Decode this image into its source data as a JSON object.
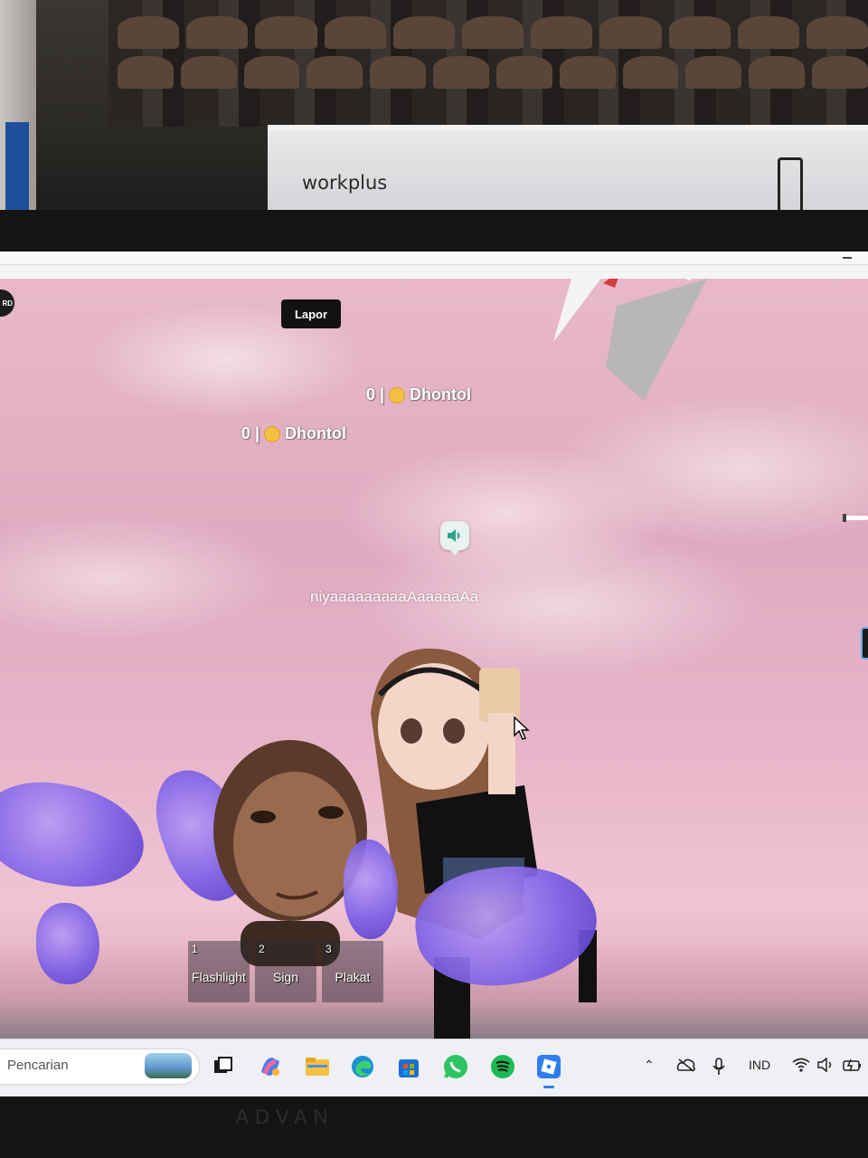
{
  "backdrop": {
    "box_brand": "workplus"
  },
  "monitor": {
    "brand": "ADVAN"
  },
  "game": {
    "record_badge": "RD",
    "report_button": "Lapor",
    "nametags": [
      {
        "text": "0 | 🙂 Dhontol"
      },
      {
        "text": "0 | 🙂 Dhontol"
      }
    ],
    "nametag_prefix": "0 |",
    "nametag_name": "Dhontol",
    "chat_message": "niyaaaaaaaaaAaaaaaAa",
    "hotbar": [
      {
        "num": "1",
        "label": "Flashlight"
      },
      {
        "num": "2",
        "label": "Sign"
      },
      {
        "num": "3",
        "label": "Plakat"
      }
    ]
  },
  "taskbar": {
    "search_placeholder": "Pencarian",
    "apps": [
      "task-view-icon",
      "copilot-icon",
      "file-explorer-icon",
      "edge-icon",
      "microsoft-store-icon",
      "whatsapp-icon",
      "spotify-icon",
      "roblox-icon"
    ],
    "language": "IND"
  },
  "colors": {
    "sky_pink": "#e6b4c8",
    "voice_green": "#2aa58a",
    "taskbar_bg": "#eef0f3"
  }
}
